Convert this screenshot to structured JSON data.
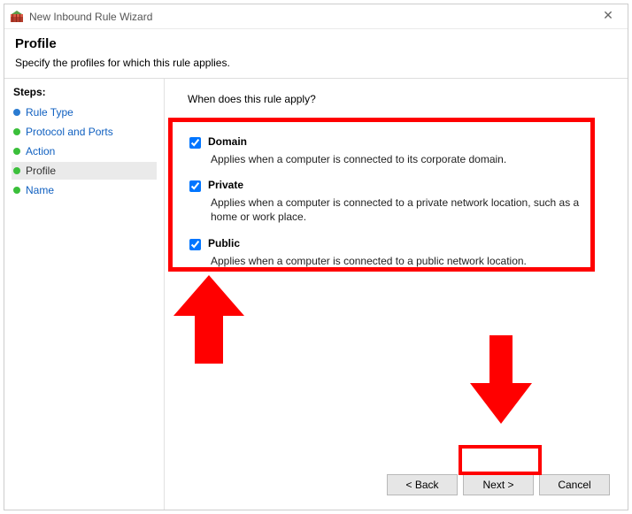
{
  "window": {
    "title": "New Inbound Rule Wizard"
  },
  "header": {
    "title": "Profile",
    "subtitle": "Specify the profiles for which this rule applies."
  },
  "steps": {
    "heading": "Steps:",
    "items": [
      {
        "label": "Rule Type",
        "current": false
      },
      {
        "label": "Protocol and Ports",
        "current": false
      },
      {
        "label": "Action",
        "current": false
      },
      {
        "label": "Profile",
        "current": true
      },
      {
        "label": "Name",
        "current": false
      }
    ]
  },
  "content": {
    "prompt": "When does this rule apply?",
    "checks": [
      {
        "title": "Domain",
        "desc": "Applies when a computer is connected to its corporate domain.",
        "checked": true
      },
      {
        "title": "Private",
        "desc": "Applies when a computer is connected to a private network location, such as a home or work place.",
        "checked": true
      },
      {
        "title": "Public",
        "desc": "Applies when a computer is connected to a public network location.",
        "checked": true
      }
    ]
  },
  "buttons": {
    "back": "< Back",
    "next": "Next >",
    "cancel": "Cancel"
  }
}
